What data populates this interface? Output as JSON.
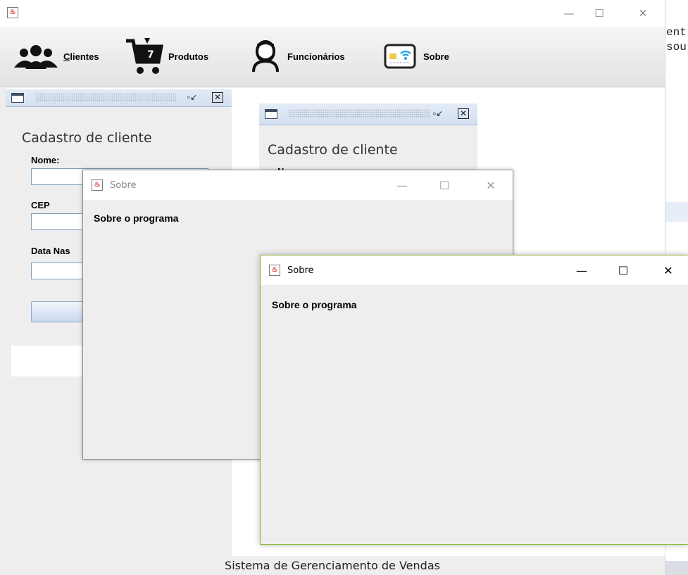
{
  "background_editor": {
    "lines": [
      "ent",
      "sou"
    ]
  },
  "main_window": {
    "controls": {
      "minimize": "—",
      "maximize": "☐",
      "close": "✕"
    },
    "menu": {
      "clientes_mnemonic": "C",
      "clientes_rest": "lientes",
      "produtos": "Produtos",
      "funcionarios": "Funcionários",
      "sobre": "Sobre"
    },
    "status": "Sistema de Gerenciamento de Vendas"
  },
  "frame1": {
    "title": "Cadastro de cliente",
    "nome_label": "Nome:",
    "cep_label": "CEP",
    "data_label": "Data Nas"
  },
  "frame2": {
    "title": "Cadastro de cliente",
    "nome_label": "Nome:"
  },
  "dialog1": {
    "title": "Sobre",
    "text": "Sobre o programa",
    "minimize": "—",
    "maximize": "☐",
    "close": "✕"
  },
  "dialog2": {
    "title": "Sobre",
    "text": "Sobre o programa",
    "minimize": "—",
    "maximize": "☐",
    "close": "✕"
  },
  "colors": {
    "accent": "#8eb838",
    "frame_title": "#d3dff0"
  }
}
